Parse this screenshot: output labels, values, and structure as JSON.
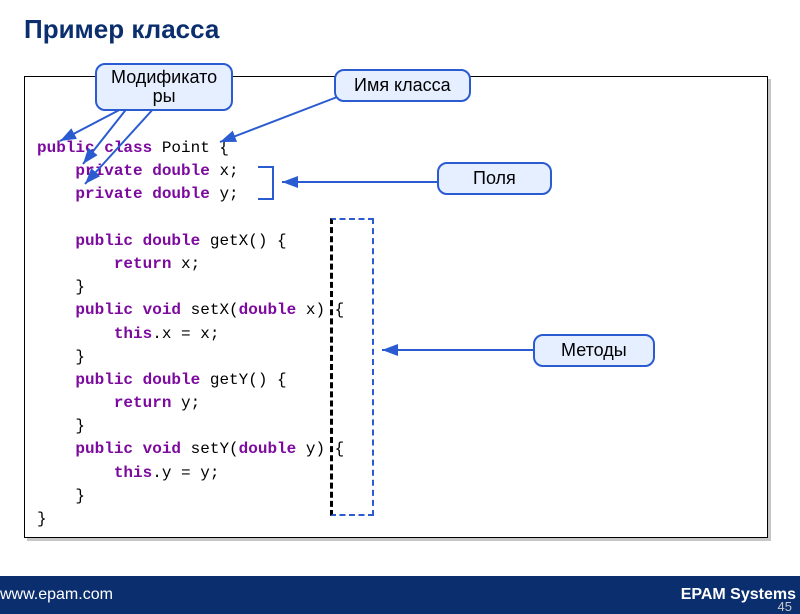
{
  "title": "Пример класса",
  "annotations": {
    "modifiers_line1": "Модификато",
    "modifiers_line2": "ры",
    "class_name": "Имя класса",
    "fields": "Поля",
    "methods": "Методы"
  },
  "code": {
    "line1_1": "public",
    "line1_2": " class",
    "line1_3": " Point {",
    "line2_1": "    private",
    "line2_2": " double",
    "line2_3": " x;",
    "line3_1": "    private",
    "line3_2": " double",
    "line3_3": " y;",
    "blank": "",
    "line5_1": "    public",
    "line5_2": " double",
    "line5_3": " getX() {",
    "line6_1": "        return",
    "line6_2": " x;",
    "line7": "    }",
    "line8_1": "    public",
    "line8_2": " void",
    "line8_3": " setX(",
    "line8_4": "double",
    "line8_5": " x) {",
    "line9_1": "        this",
    "line9_2": ".x = x;",
    "line10": "    }",
    "line11_1": "    public",
    "line11_2": " double",
    "line11_3": " getY() {",
    "line12_1": "        return",
    "line12_2": " y;",
    "line13": "    }",
    "line14_1": "    public",
    "line14_2": " void",
    "line14_3": " setY(",
    "line14_4": "double",
    "line14_5": " y) {",
    "line15_1": "        this",
    "line15_2": ".y = y;",
    "line16": "    }",
    "line17": "}"
  },
  "footer": {
    "left": "www.epam.com",
    "right": "EPAM Systems"
  },
  "page": "45"
}
